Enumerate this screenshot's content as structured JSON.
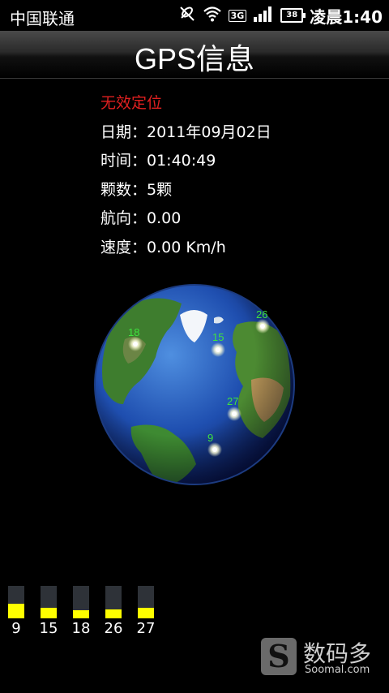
{
  "status_bar": {
    "carrier": "中国联通",
    "network": "3G",
    "battery": "38",
    "time": "凌晨1:40",
    "icons": [
      "gps-off-icon",
      "wifi-icon",
      "3g-icon",
      "signal-icon",
      "battery-icon"
    ]
  },
  "header": {
    "title": "GPS信息"
  },
  "gps_info": {
    "fix_status": "无效定位",
    "date": "日期：2011年09月02日",
    "time": "时间：01:40:49",
    "count": "颗数：5颗",
    "heading": "航向：0.00",
    "speed": "速度：0.00 Km/h"
  },
  "globe": {
    "satellites": [
      {
        "id": "18"
      },
      {
        "id": "15"
      },
      {
        "id": "26"
      },
      {
        "id": "27"
      },
      {
        "id": "9"
      }
    ]
  },
  "signal_bars": [
    {
      "label": "9",
      "level": 0.45
    },
    {
      "label": "15",
      "level": 0.32
    },
    {
      "label": "18",
      "level": 0.25
    },
    {
      "label": "26",
      "level": 0.28
    },
    {
      "label": "27",
      "level": 0.32
    }
  ],
  "watermark": {
    "glyph": "S",
    "name": "数码多",
    "site": "Soomal.com"
  },
  "colors": {
    "fix_status": "#e02020",
    "satellite_label": "#3fe23f",
    "signal_fill": "#ffff00",
    "signal_empty": "#2e3238"
  }
}
